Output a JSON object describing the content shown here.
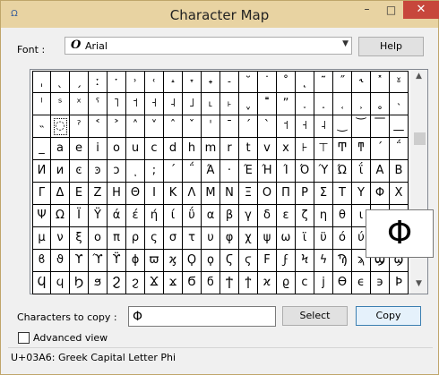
{
  "window": {
    "title": "Character Map",
    "app_icon": "charmap-icon",
    "controls": {
      "minimize": "–",
      "maximize": "□",
      "close": "✕"
    }
  },
  "font": {
    "label": "Font :",
    "value": "Arial",
    "icon_glyph": "O",
    "help_label": "Help"
  },
  "grid": {
    "rows": [
      [
        "ˌ",
        "ˎ",
        "ˏ",
        "ː",
        "ˑ",
        "˒",
        "˓",
        "˔",
        "˕",
        "˖",
        "˗",
        "˘",
        "˙",
        "˚",
        "˛",
        "˜",
        "˝",
        "˞",
        "˟",
        "ˠ"
      ],
      [
        "ˡ",
        "ˢ",
        "ˣ",
        "ˤ",
        "˥",
        "˦",
        "˧",
        "˨",
        "˩",
        "˪",
        "˫",
        "ˬ",
        "˭",
        "ˮ",
        "˯",
        "˰",
        "˱",
        "˲",
        "˳",
        "˴"
      ],
      [
        "˵",
        "◌",
        "ˀ",
        "˂",
        "˃",
        "˄",
        "˅",
        "ˆ",
        "ˇ",
        "ˈ",
        "ˉ",
        "ˊ",
        "ˋ",
        "˦",
        "˧",
        "˨",
        "͜",
        "͝",
        "͞",
        "͟"
      ],
      [
        "_",
        "a",
        "e",
        "i",
        "o",
        "u",
        "c",
        "d",
        "h",
        "m",
        "r",
        "t",
        "v",
        "x",
        "⊦",
        "⊤",
        "Ͳ",
        "ͳ",
        "´",
        "΅"
      ],
      [
        "И",
        "и",
        "ͼ",
        "ͽ",
        "ͻ",
        "ͺ",
        ";",
        "΄",
        "΅",
        "Ά",
        "·",
        "Έ",
        "Ή",
        "Ί",
        "Ό",
        "Ύ",
        "Ώ",
        "ΐ",
        "Α",
        "Β"
      ],
      [
        "Γ",
        "Δ",
        "Ε",
        "Ζ",
        "Η",
        "Θ",
        "Ι",
        "Κ",
        "Λ",
        "Μ",
        "Ν",
        "Ξ",
        "Ο",
        "Π",
        "Ρ",
        "Σ",
        "Τ",
        "Υ",
        "Φ",
        "Χ"
      ],
      [
        "Ψ",
        "Ω",
        "Ϊ",
        "Ϋ",
        "ά",
        "έ",
        "ή",
        "ί",
        "ΰ",
        "α",
        "β",
        "γ",
        "δ",
        "ε",
        "ζ",
        "η",
        "θ",
        "ι",
        "κ",
        "λ"
      ],
      [
        "μ",
        "ν",
        "ξ",
        "ο",
        "π",
        "ρ",
        "ς",
        "σ",
        "τ",
        "υ",
        "φ",
        "χ",
        "ψ",
        "ω",
        "ϊ",
        "ϋ",
        "ό",
        "ύ",
        "ώ",
        "Ϗ"
      ],
      [
        "ϐ",
        "ϑ",
        "ϒ",
        "ϓ",
        "ϔ",
        "ϕ",
        "ϖ",
        "ϗ",
        "Ϙ",
        "ϙ",
        "Ϛ",
        "ϛ",
        "Ϝ",
        "ϝ",
        "Ϟ",
        "ϟ",
        "Ϡ",
        "ϡ",
        "Ϣ",
        "ϣ"
      ],
      [
        "Ϥ",
        "ϥ",
        "Ϧ",
        "ϧ",
        "Ϩ",
        "ϩ",
        "Ϫ",
        "ϫ",
        "Ϭ",
        "ϭ",
        "Ϯ",
        "ϯ",
        "ϰ",
        "ϱ",
        "ϲ",
        "ϳ",
        "ϴ",
        "ϵ",
        "϶",
        "Ϸ"
      ]
    ],
    "enlarged_char": "Φ"
  },
  "copy": {
    "label": "Characters to copy :",
    "value": "Φ",
    "select_label": "Select",
    "copy_label": "Copy"
  },
  "advanced": {
    "label": "Advanced view",
    "checked": false
  },
  "status": {
    "text": "U+03A6: Greek Capital Letter Phi"
  }
}
